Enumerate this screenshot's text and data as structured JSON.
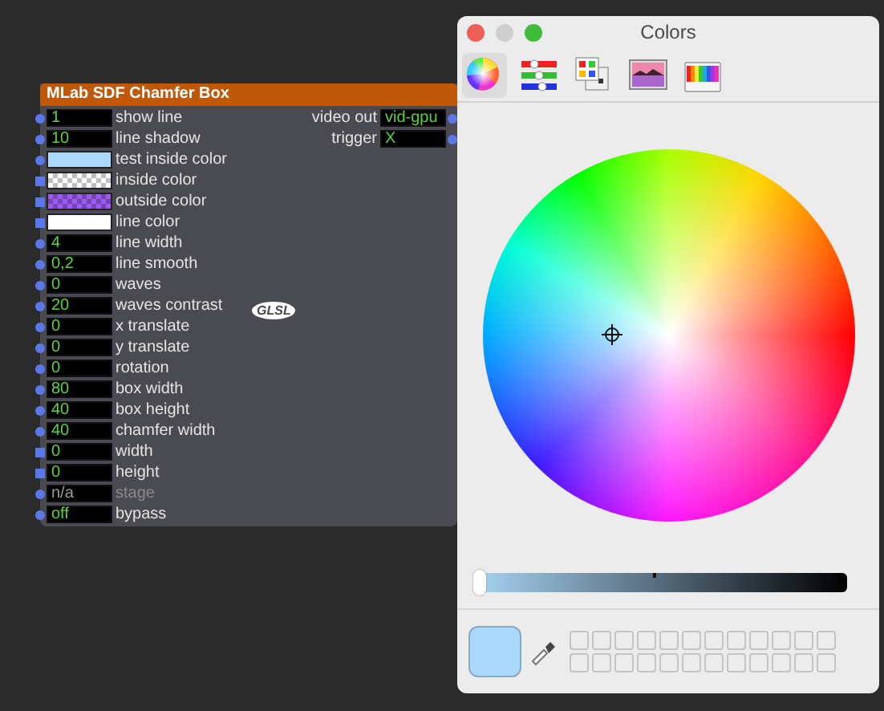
{
  "node": {
    "title": "MLab SDF Chamfer Box",
    "badge": "GLSL",
    "inputs": [
      {
        "kind": "value",
        "value": "1",
        "label": "show line",
        "square_inlet": false,
        "disabled": false
      },
      {
        "kind": "value",
        "value": "10",
        "label": "line shadow",
        "square_inlet": false,
        "disabled": false
      },
      {
        "kind": "color",
        "color": "#aad8fa",
        "checkered": false,
        "label": "test inside color",
        "square_inlet": false,
        "disabled": false
      },
      {
        "kind": "color",
        "color": "#ffffff",
        "checkered": true,
        "label": "inside color",
        "square_inlet": true,
        "disabled": false
      },
      {
        "kind": "color",
        "color": "#9c5cf0",
        "checkered": true,
        "label": "outside color",
        "square_inlet": true,
        "disabled": false
      },
      {
        "kind": "color",
        "color": "#ffffff",
        "checkered": false,
        "label": "line color",
        "square_inlet": true,
        "disabled": false
      },
      {
        "kind": "value",
        "value": "4",
        "label": "line width",
        "square_inlet": false,
        "disabled": false
      },
      {
        "kind": "value",
        "value": "0,2",
        "label": "line smooth",
        "square_inlet": false,
        "disabled": false
      },
      {
        "kind": "value",
        "value": "0",
        "label": "waves",
        "square_inlet": false,
        "disabled": false
      },
      {
        "kind": "value",
        "value": "20",
        "label": "waves contrast",
        "square_inlet": false,
        "disabled": false
      },
      {
        "kind": "value",
        "value": "0",
        "label": "x translate",
        "square_inlet": false,
        "disabled": false
      },
      {
        "kind": "value",
        "value": "0",
        "label": "y translate",
        "square_inlet": false,
        "disabled": false
      },
      {
        "kind": "value",
        "value": "0",
        "label": "rotation",
        "square_inlet": false,
        "disabled": false
      },
      {
        "kind": "value",
        "value": "80",
        "label": "box width",
        "square_inlet": false,
        "disabled": false
      },
      {
        "kind": "value",
        "value": "40",
        "label": "box height",
        "square_inlet": false,
        "disabled": false
      },
      {
        "kind": "value",
        "value": "40",
        "label": "chamfer width",
        "square_inlet": false,
        "disabled": false
      },
      {
        "kind": "value",
        "value": "0",
        "label": "width",
        "square_inlet": true,
        "disabled": false
      },
      {
        "kind": "value",
        "value": "0",
        "label": "height",
        "square_inlet": true,
        "disabled": false
      },
      {
        "kind": "value",
        "value": "n/a",
        "label": "stage",
        "square_inlet": false,
        "disabled": true
      },
      {
        "kind": "value",
        "value": "off",
        "label": "bypass",
        "square_inlet": false,
        "disabled": false
      }
    ],
    "outputs": [
      {
        "label": "video out",
        "value": "vid-gpu"
      },
      {
        "label": "trigger",
        "value": "X"
      }
    ]
  },
  "colors_window": {
    "title": "Colors",
    "tabs": [
      {
        "kind": "wheel",
        "selected": true
      },
      {
        "kind": "sliders",
        "selected": false
      },
      {
        "kind": "palettes",
        "selected": false
      },
      {
        "kind": "image",
        "selected": false
      },
      {
        "kind": "pencils",
        "selected": false
      }
    ],
    "brightness": {
      "level": 0
    },
    "current_color": {
      "color": "#aad8fc"
    }
  }
}
